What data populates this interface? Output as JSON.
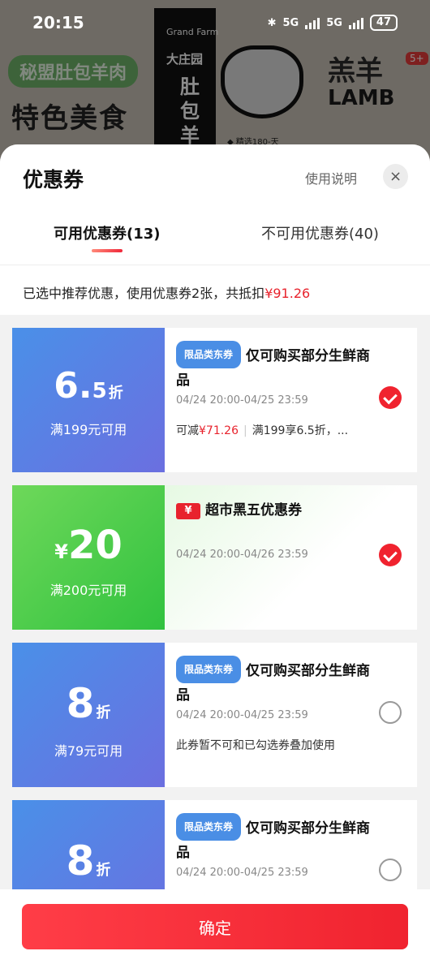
{
  "status_bar": {
    "time": "20:15",
    "battery": "47",
    "network_1": "5G",
    "network_2": "5G"
  },
  "background_page": {
    "tag": "秘盟肚包羊肉",
    "title": "特色美食",
    "brand_en": "Grand Farm",
    "brand_cn": "大庄园",
    "product_vertical": "肚包羊",
    "lamb_cn": "羔羊",
    "lamb_en": "LAMB",
    "badge": "5+",
    "small_text": "◆ 精选180-天"
  },
  "sheet": {
    "title": "优惠券",
    "instructions": "使用说明",
    "close_icon": "×",
    "tabs": [
      {
        "label": "可用优惠券(13)"
      },
      {
        "label": "不可用优惠券(40)"
      }
    ],
    "summary": {
      "text": "已选中推荐优惠，使用优惠券2张，共抵扣",
      "amount": "¥91.26"
    }
  },
  "coupons": [
    {
      "value_main": "6.",
      "value_sub": "5",
      "value_unit": "折",
      "condition": "满199元可用",
      "tag": "限品类东券",
      "title": "仅可购买部分生鲜商品",
      "date": "04/24 20:00-04/25 23:59",
      "note_prefix": "可减",
      "note_amount": "¥71.26",
      "note_suffix": "满199享6.5折，...",
      "selected": true
    },
    {
      "value_prefix": "¥",
      "value_main": "20",
      "condition": "满200元可用",
      "icon": "¥",
      "title": "超市黑五优惠券",
      "date": "04/24 20:00-04/26 23:59",
      "selected": true
    },
    {
      "value_main": "8",
      "value_unit": "折",
      "condition": "满79元可用",
      "tag": "限品类东券",
      "title": "仅可购买部分生鲜商品",
      "date": "04/24 20:00-04/25 23:59",
      "note": "此券暂不可和已勾选券叠加使用",
      "selected": false
    },
    {
      "value_main": "8",
      "value_unit": "折",
      "tag": "限品类东券",
      "title": "仅可购买部分生鲜商品",
      "date": "04/24 20:00-04/25 23:59",
      "selected": false
    }
  ],
  "footer": {
    "confirm_label": "确定"
  },
  "colors": {
    "accent_red": "#f0232f",
    "coupon_blue": "#4a90e8",
    "coupon_green": "#31c23f"
  }
}
